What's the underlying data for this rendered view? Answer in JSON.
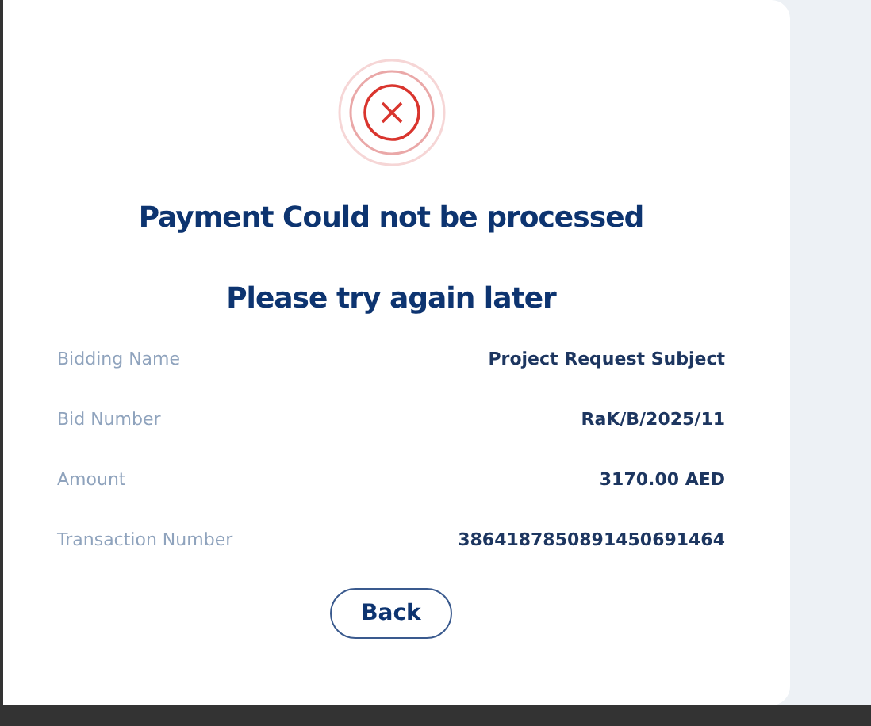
{
  "status": {
    "title": "Payment Could not be processed",
    "subtitle": "Please try again later"
  },
  "details": [
    {
      "label": "Bidding Name",
      "value": "Project Request Subject"
    },
    {
      "label": "Bid Number",
      "value": "RaK/B/2025/11"
    },
    {
      "label": "Amount",
      "value": "3170.00 AED"
    },
    {
      "label": "Transaction Number",
      "value": "3864187850891450691464"
    }
  ],
  "buttons": [
    {
      "label": "Back"
    }
  ]
}
